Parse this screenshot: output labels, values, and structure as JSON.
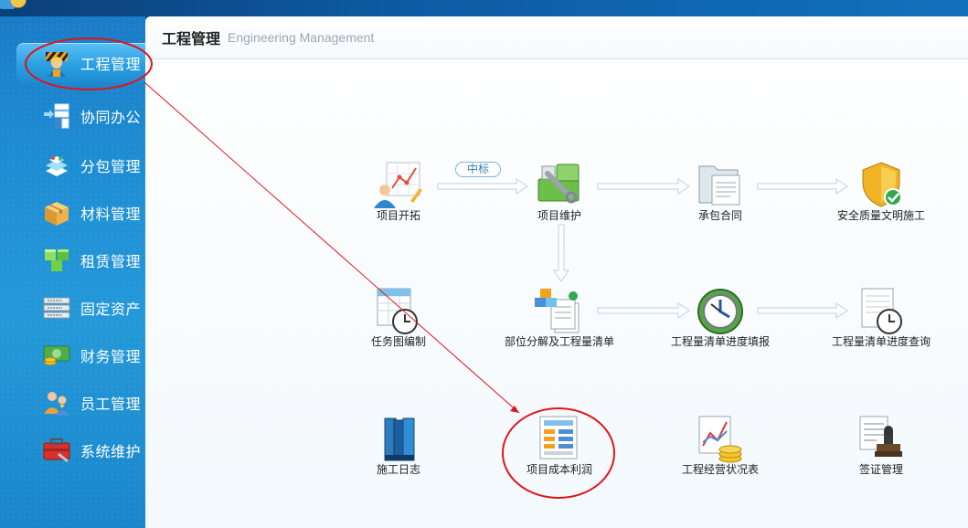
{
  "sidebar": {
    "items": [
      {
        "label": "工程管理",
        "icon": "worker-icon",
        "active": true
      },
      {
        "label": "协同办公",
        "icon": "collaboration-icon"
      },
      {
        "label": "分包管理",
        "icon": "subcontract-icon"
      },
      {
        "label": "材料管理",
        "icon": "materials-box-icon"
      },
      {
        "label": "租赁管理",
        "icon": "rental-cubes-icon"
      },
      {
        "label": "固定资产",
        "icon": "server-rack-icon"
      },
      {
        "label": "财务管理",
        "icon": "money-icon"
      },
      {
        "label": "员工管理",
        "icon": "employees-icon"
      },
      {
        "label": "系统维护",
        "icon": "toolbox-icon"
      }
    ]
  },
  "header": {
    "title": "工程管理",
    "subtitle": "Engineering Management"
  },
  "flow": {
    "pill_label": "中标",
    "modules": [
      {
        "key": "project_dev",
        "label": "项目开拓",
        "icon": "project-chart-icon"
      },
      {
        "key": "project_maint",
        "label": "项目维护",
        "icon": "wrench-tool-icon"
      },
      {
        "key": "contract",
        "label": "承包合同",
        "icon": "folder-document-icon"
      },
      {
        "key": "safety",
        "label": "安全质量文明施工",
        "icon": "shield-check-icon"
      },
      {
        "key": "task_chart",
        "label": "任务图编制",
        "icon": "schedule-clock-icon"
      },
      {
        "key": "decompose",
        "label": "部位分解及工程量清单",
        "icon": "blocks-list-icon"
      },
      {
        "key": "progress_fill",
        "label": "工程量清单进度填报",
        "icon": "compass-clock-icon"
      },
      {
        "key": "progress_query",
        "label": "工程量清单进度查询",
        "icon": "document-clock-icon"
      },
      {
        "key": "daily_log",
        "label": "施工日志",
        "icon": "books-icon"
      },
      {
        "key": "cost_profit",
        "label": "项目成本利润",
        "icon": "cost-report-icon"
      },
      {
        "key": "operations",
        "label": "工程经营状况表",
        "icon": "chart-coins-icon"
      },
      {
        "key": "visa",
        "label": "签证管理",
        "icon": "stamp-icon"
      }
    ]
  },
  "colors": {
    "annotation_red": "#e0141a",
    "sidebar_blue": "#1e8ed4",
    "arrow_light": "#c9dceb"
  }
}
